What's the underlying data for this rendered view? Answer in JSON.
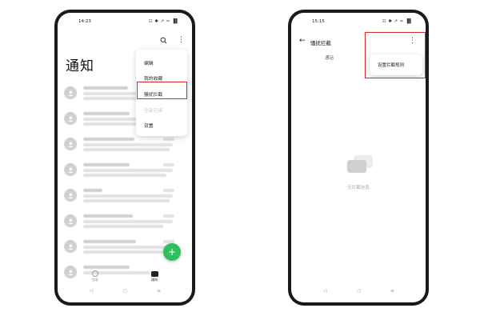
{
  "left_screen": {
    "status_time": "14:23",
    "status_icons": "☷ ✱ ↗ ≈ ▐▌",
    "title": "通知",
    "menu": {
      "items": [
        {
          "label": "编辑",
          "enabled": true
        },
        {
          "label": "我的收藏",
          "enabled": true
        },
        {
          "label": "骚扰拦截",
          "enabled": true,
          "highlighted": true
        },
        {
          "label": "全部已读",
          "enabled": false
        },
        {
          "label": "设置",
          "enabled": true
        }
      ]
    },
    "fab_label": "+",
    "bottom_nav": [
      {
        "label": "信息",
        "active": false
      },
      {
        "label": "通知",
        "active": true
      }
    ],
    "icons": {
      "search": "search-icon",
      "more": "more-vertical-icon"
    }
  },
  "right_screen": {
    "status_time": "15:15",
    "status_icons": "☷ ✱ ↗ ≈ ▐▌",
    "title": "骚扰拦截",
    "tab": "通话",
    "popup_item": "设置拦截规则",
    "empty_text": "无拦截信息"
  },
  "system_nav": {
    "back": "◁",
    "home": "○",
    "recents": "≡"
  },
  "colors": {
    "highlight": "#e02424",
    "fab": "#2fbf5f"
  }
}
